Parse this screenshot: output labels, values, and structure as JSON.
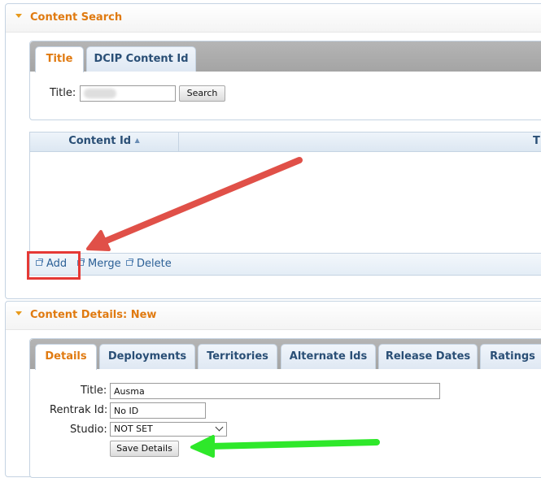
{
  "content_search": {
    "title": "Content Search",
    "tabs": [
      {
        "label": "Title",
        "active": true
      },
      {
        "label": "DCIP Content Id",
        "active": false
      }
    ],
    "title_label": "Title:",
    "title_value": "",
    "search_button": "Search",
    "grid": {
      "columns": [
        "Content Id",
        "T"
      ],
      "sort_indicator": "▲",
      "rows": []
    },
    "actions": {
      "add": "Add",
      "merge": "Merge",
      "delete": "Delete"
    }
  },
  "content_details": {
    "title": "Content Details: New",
    "tabs": [
      {
        "label": "Details",
        "active": true
      },
      {
        "label": "Deployments",
        "active": false
      },
      {
        "label": "Territories",
        "active": false
      },
      {
        "label": "Alternate Ids",
        "active": false
      },
      {
        "label": "Release Dates",
        "active": false
      },
      {
        "label": "Ratings",
        "active": false
      }
    ],
    "fields": {
      "title_label": "Title:",
      "title_value": "Ausma",
      "rentrak_label": "Rentrak Id:",
      "rentrak_value": "No ID",
      "studio_label": "Studio:",
      "studio_value": "NOT SET"
    },
    "save_button": "Save Details"
  },
  "annotations": {
    "highlight_color": "#e53935",
    "red_arrow_color": "#e05048",
    "green_arrow_color": "#2ee82a"
  }
}
